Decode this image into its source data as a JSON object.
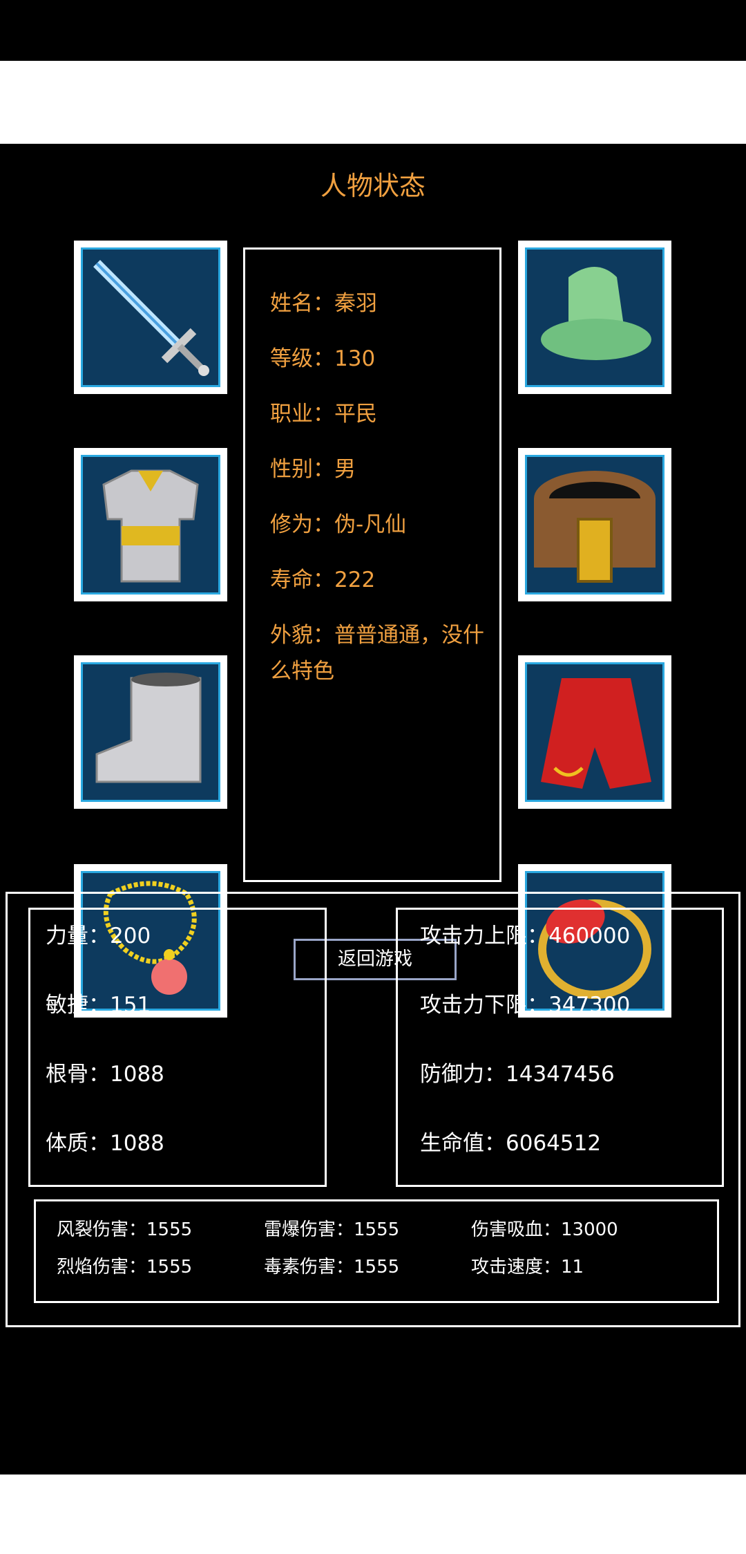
{
  "title": "人物状态",
  "info": {
    "name": "姓名：秦羽",
    "level": "等级：130",
    "job": "职业：平民",
    "gender": "性别：男",
    "cultivation": "修为：伪-凡仙",
    "lifespan": "寿命：222",
    "appearance": "外貌：普普通通，没什么特色"
  },
  "back_button": "返回游戏",
  "equipment": [
    "sword-icon",
    "hat-icon",
    "armor-icon",
    "belt-icon",
    "boots-icon",
    "cape-icon",
    "necklace-icon",
    "ring-icon"
  ],
  "attributes": {
    "strength": "力量：200",
    "agility": "敏捷：151",
    "bone": "根骨：1088",
    "constitution": "体质：1088"
  },
  "combat": {
    "attack_max": "攻击力上限：460000",
    "attack_min": "攻击力下限：347300",
    "defense": "防御力：14347456",
    "hp": "生命值：6064512"
  },
  "elemental": {
    "wind": "风裂伤害：1555",
    "thunder": "雷爆伤害：1555",
    "lifesteal": "伤害吸血：13000",
    "flame": "烈焰伤害：1555",
    "poison": "毒素伤害：1555",
    "attack_speed": "攻击速度：11"
  }
}
